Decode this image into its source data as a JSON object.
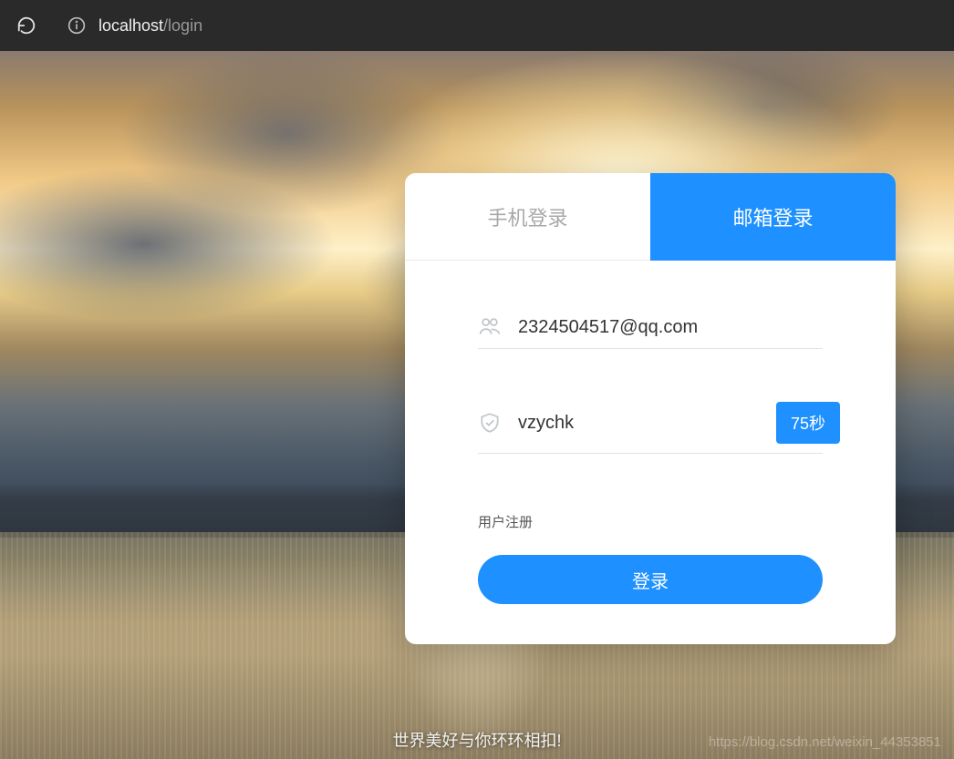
{
  "browser": {
    "url_host": "localhost",
    "url_path": "/login"
  },
  "tabs": {
    "phone_label": "手机登录",
    "email_label": "邮箱登录"
  },
  "form": {
    "email_value": "2324504517@qq.com",
    "code_value": "vzychk",
    "countdown_label": "75秒",
    "register_label": "用户注册",
    "login_button_label": "登录"
  },
  "footer": {
    "watermark_text": "世界美好与你环环相扣!",
    "watermark_url": "https://blog.csdn.net/weixin_44353851"
  }
}
